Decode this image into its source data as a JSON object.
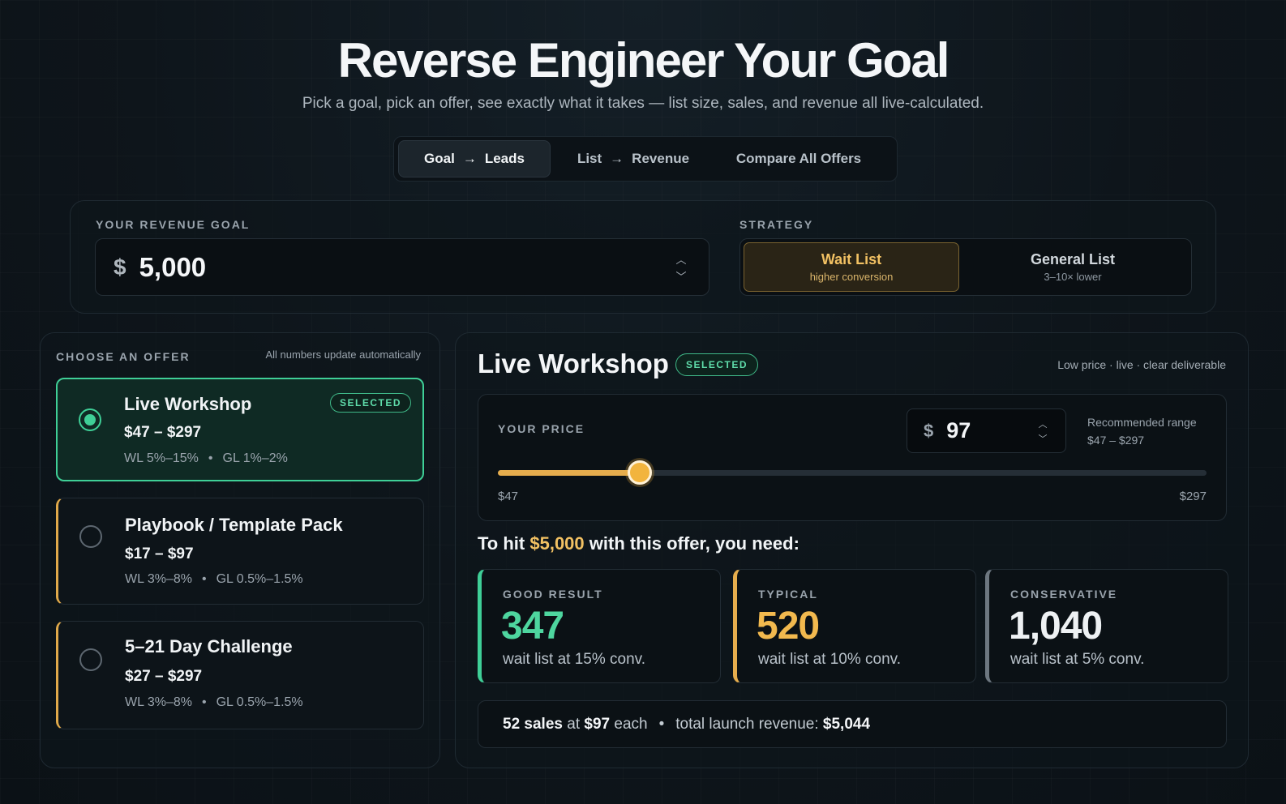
{
  "header": {
    "title": "Reverse Engineer Your Goal",
    "subtitle": "Pick a goal, pick an offer, see exactly what it takes — list size, sales, and revenue all live-calculated."
  },
  "tabs": [
    {
      "from": "Goal",
      "to": "Leads",
      "active": true
    },
    {
      "from": "List",
      "to": "Revenue",
      "active": false
    },
    {
      "label": "Compare All Offers",
      "active": false
    }
  ],
  "goal": {
    "label": "YOUR REVENUE GOAL",
    "currency": "$",
    "value": "5,000"
  },
  "strategy": {
    "label": "STRATEGY",
    "options": [
      {
        "name": "Wait List",
        "sub": "higher conversion",
        "active": true
      },
      {
        "name": "General List",
        "sub": "3–10× lower",
        "active": false
      }
    ]
  },
  "offers": {
    "heading": "CHOOSE AN OFFER",
    "note": "All numbers update automatically",
    "selected_badge": "SELECTED",
    "items": [
      {
        "name": "Live Workshop",
        "price": "$47 – $297",
        "wl": "WL 5%–15%",
        "gl": "GL 1%–2%",
        "selected": true
      },
      {
        "name": "Playbook / Template Pack",
        "price": "$17 – $97",
        "wl": "WL 3%–8%",
        "gl": "GL 0.5%–1.5%",
        "selected": false
      },
      {
        "name": "5–21 Day Challenge",
        "price": "$27 – $297",
        "wl": "WL 3%–8%",
        "gl": "GL 0.5%–1.5%",
        "selected": false
      }
    ]
  },
  "detail": {
    "title": "Live Workshop",
    "badge": "SELECTED",
    "tagline": "Low price · live · clear deliverable",
    "price": {
      "label": "YOUR PRICE",
      "currency": "$",
      "value": "97",
      "recommended_label": "Recommended range",
      "recommended_range": "$47 – $297",
      "min_label": "$47",
      "max_label": "$297",
      "min": 47,
      "max": 297,
      "current": 97
    },
    "need": {
      "prefix": "To hit",
      "amount": "$5,000",
      "suffix": "with this offer, you need:"
    },
    "results": [
      {
        "label": "GOOD RESULT",
        "value": "347",
        "desc": "wait list at 15% conv."
      },
      {
        "label": "TYPICAL",
        "value": "520",
        "desc": "wait list at 10% conv."
      },
      {
        "label": "CONSERVATIVE",
        "value": "1,040",
        "desc": "wait list at 5% conv."
      }
    ],
    "summary": {
      "sales": "52 sales",
      "at": "at",
      "price": "$97",
      "each": "each",
      "revenue_label": "total launch revenue:",
      "revenue": "$5,044"
    }
  },
  "colors": {
    "accent_green": "#3fcf97",
    "accent_gold": "#e6ad4d",
    "background": "#0e151b"
  }
}
